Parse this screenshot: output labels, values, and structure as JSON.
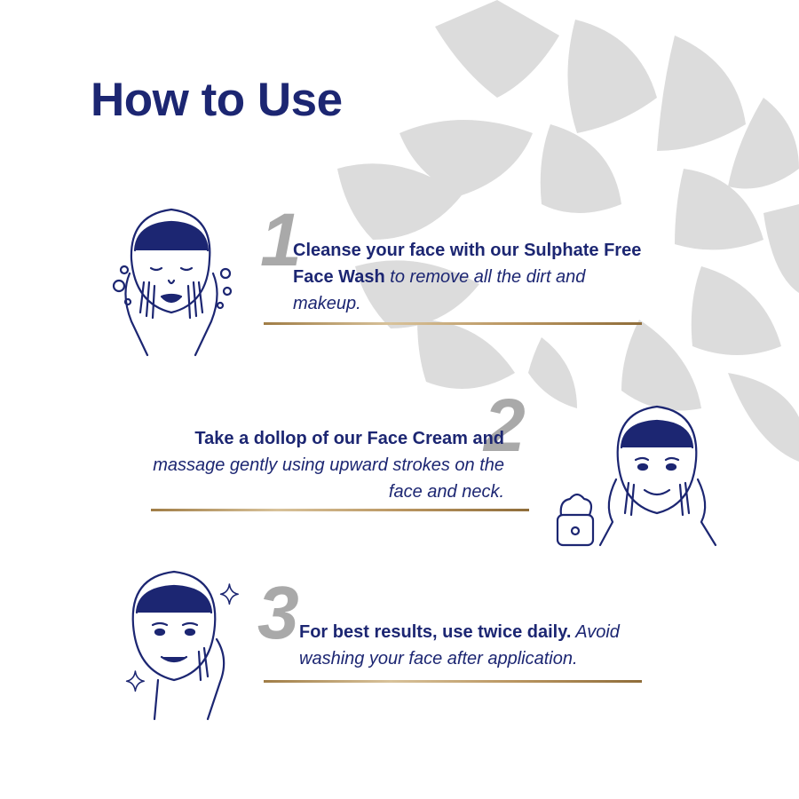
{
  "page": {
    "title": "How to Use"
  },
  "colors": {
    "navy": "#1c2672",
    "grey_number": "#a9a9a9",
    "gold_divider": "#b99560",
    "flower": "#dcdcdc"
  },
  "steps": [
    {
      "number": "1",
      "bold": "Cleanse your face with our Sulphate Free Face Wash",
      "italic": " to remove all the dirt and makeup.",
      "icon": "face-washing-illustration"
    },
    {
      "number": "2",
      "bold": "Take a dollop of our Face Cream and",
      "italic": "massage gently using upward strokes on the face and neck.",
      "icon": "face-cream-illustration"
    },
    {
      "number": "3",
      "bold": "For best results, use twice daily.",
      "italic": " Avoid washing your face after application.",
      "icon": "glowing-face-illustration"
    }
  ]
}
